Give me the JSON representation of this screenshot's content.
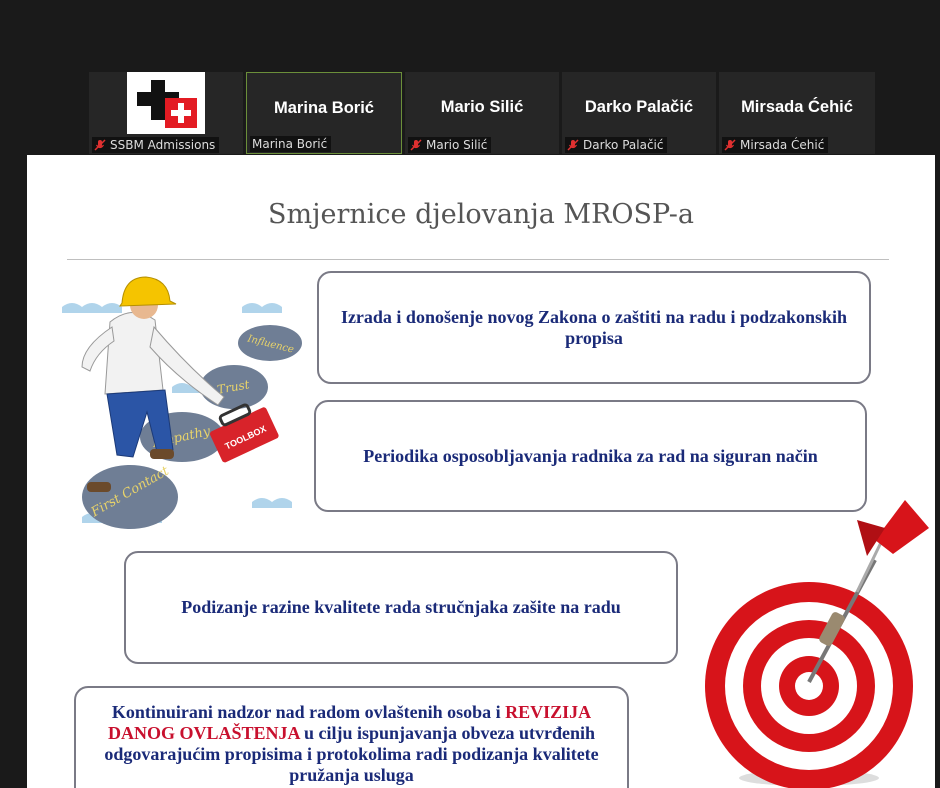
{
  "participants": [
    {
      "name": "",
      "label": "SSBM Admissions",
      "muted": true,
      "has_logo": true
    },
    {
      "name": "Marina Borić",
      "label": "Marina Borić",
      "muted": false,
      "active": true
    },
    {
      "name": "Mario Silić",
      "label": "Mario Silić",
      "muted": true
    },
    {
      "name": "Darko Palačić",
      "label": "Darko Palačić",
      "muted": true
    },
    {
      "name": "Mirsada Ćehić",
      "label": "Mirsada Ćehić",
      "muted": true
    }
  ],
  "slide": {
    "title": "Smjernice djelovanja MROSP-a",
    "box1": "Izrada i donošenje novog Zakona o zaštiti na radu i podzakonskih propisa",
    "box2": "Periodika osposobljavanja radnika za rad na siguran način",
    "box3": "Podizanje razine kvalitete rada stručnjaka zašite na radu",
    "box4": {
      "part1": "Kontinuirani nadzor nad radom ovlaštenih osoba i ",
      "highlight": "REVIZIJA DANOG OVLAŠTENJA",
      "part2": " u cilju ispunjavanja obveza utvrđenih odgovarajućim propisima i protokolima radi podizanja kvalitete pružanja usluga"
    },
    "stones": [
      "Influence",
      "Trust",
      "Empathy",
      "First Contact"
    ],
    "toolbox_text": "TOOLBOX"
  },
  "colors": {
    "muted_mic": "#e03030",
    "box_text": "#1a2a78",
    "highlight": "#c8102e",
    "active_border": "#6b8f3a"
  }
}
